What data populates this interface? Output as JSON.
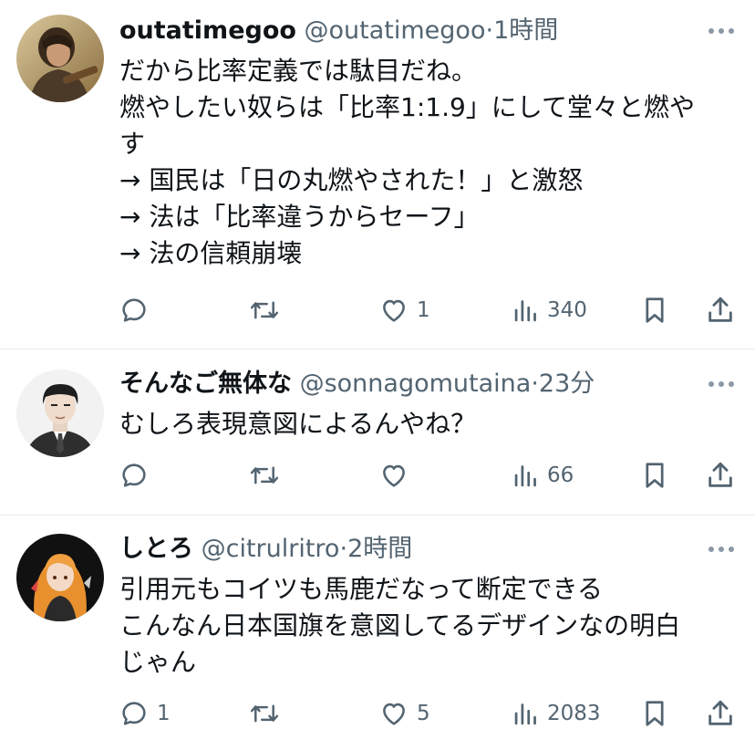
{
  "tweets": [
    {
      "display_name": "outatimegoo",
      "handle": "@outatimegoo",
      "separator": "·",
      "time": "1時間",
      "lines": [
        "だから比率定義では駄目だね。",
        "燃やしたい奴らは「比率1:1.9」にして堂々と燃や",
        "す",
        "→ 国民は「日の丸燃やされた！」と激怒",
        "→ 法は「比率違うからセーフ」",
        "→ 法の信頼崩壊"
      ],
      "reply_count": "",
      "retweet_count": "",
      "like_count": "1",
      "view_count": "340",
      "avatar_icon": "photo-avatar-person",
      "more_icon": "more-options-icon"
    },
    {
      "display_name": "そんなご無体な",
      "handle": "@sonnagomutaina",
      "separator": "·",
      "time": "23分",
      "lines": [
        "むしろ表現意図によるんやね？"
      ],
      "reply_count": "",
      "retweet_count": "",
      "like_count": "",
      "view_count": "66",
      "avatar_icon": "illustrated-man-avatar",
      "more_icon": "more-options-icon"
    },
    {
      "display_name": "しとろ",
      "handle": "@citrulritro",
      "separator": "·",
      "time": "2時間",
      "lines": [
        "引用元もコイツも馬鹿だなって断定できる",
        "こんなん日本国旗を意図してるデザインなの明白",
        "じゃん"
      ],
      "reply_count": "1",
      "retweet_count": "",
      "like_count": "5",
      "view_count": "2083",
      "avatar_icon": "anime-girl-avatar",
      "more_icon": "more-options-icon"
    }
  ],
  "icons": {
    "reply": "reply-icon",
    "retweet": "retweet-icon",
    "like": "like-icon",
    "views": "views-icon",
    "bookmark": "bookmark-icon",
    "share": "share-icon"
  },
  "colors": {
    "text": "#0f1419",
    "secondary": "#536471",
    "divider": "#e6e9ec"
  }
}
